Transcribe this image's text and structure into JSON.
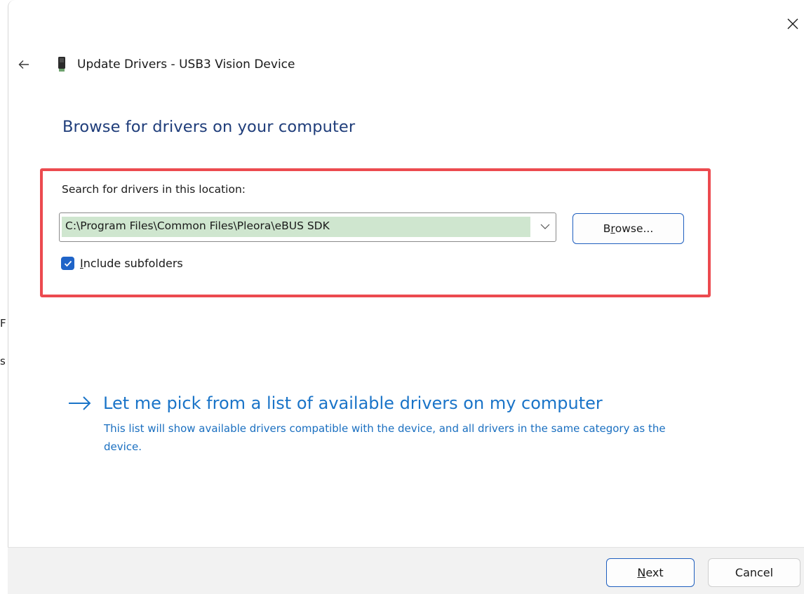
{
  "backdrop": {
    "fragments": [
      "F",
      "s"
    ]
  },
  "window": {
    "title": "Update Drivers - USB3 Vision Device",
    "close_icon": "close-icon",
    "back_icon": "back-arrow-icon",
    "device_icon": "usb-device-icon"
  },
  "page": {
    "heading": "Browse for drivers on your computer",
    "search_label": "Search for drivers in this location:",
    "location_value": "C:\\Program Files\\Common Files\\Pleora\\eBUS SDK",
    "browse_button": {
      "mnemonic": "r",
      "prefix": "B",
      "suffix": "owse..."
    },
    "include_subfolders": {
      "checked": true,
      "mnemonic": "I",
      "rest": "nclude subfolders"
    },
    "pick_link": "Let me pick from a list of available drivers on my computer",
    "pick_description": "This list will show available drivers compatible with the device, and all drivers in the same category as the device."
  },
  "footer": {
    "next_button": {
      "mnemonic": "N",
      "rest": "ext"
    },
    "cancel_button": "Cancel"
  },
  "colors": {
    "heading": "#1f3d7a",
    "link": "#1a74c8",
    "highlight_border": "#ec4a4f",
    "checkbox_fill": "#1f64c8",
    "field_highlight": "#cfe6cf",
    "footer_bg": "#f2f2f2"
  }
}
